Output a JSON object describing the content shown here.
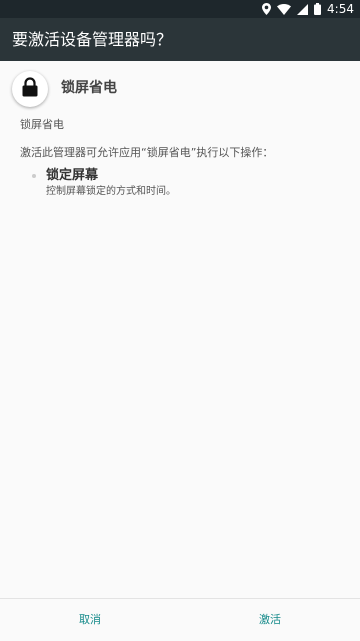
{
  "status_bar": {
    "time": "4:54",
    "icons": [
      "location-icon",
      "wifi-icon",
      "signal-icon",
      "battery-icon"
    ]
  },
  "app_bar": {
    "title": "要激活设备管理器吗？"
  },
  "admin": {
    "icon": "lock-icon",
    "name": "锁屏省电",
    "description": "锁屏省电"
  },
  "policies": {
    "intro": "激活此管理器可允许应用“锁屏省电”执行以下操作：",
    "items": [
      {
        "title": "锁定屏幕",
        "description": "控制屏幕锁定的方式和时间。"
      }
    ]
  },
  "actions": {
    "cancel_label": "取消",
    "activate_label": "激活",
    "accent_color": "#158a8a"
  }
}
